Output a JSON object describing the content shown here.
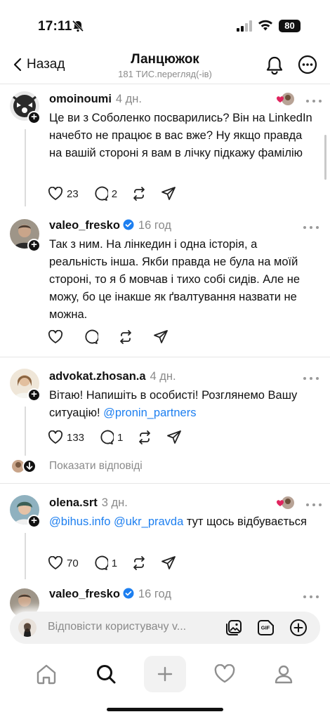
{
  "status_bar": {
    "time": "17:11",
    "battery": "80"
  },
  "header": {
    "back_label": "Назад",
    "title": "Ланцюжок",
    "subtitle": "181 ТИС.перегляд(-ів)"
  },
  "posts": [
    {
      "username": "omoinoumi",
      "time": "4 дн.",
      "verified": false,
      "text": "Це ви з Соболенко посварились? Він на LinkedIn начебто не працює в вас вже? Ну якщо правда на вашій стороні я вам в лічку підкажу фамілію",
      "likes": "23",
      "comments": "2"
    },
    {
      "username": "valeo_fresko",
      "time": "16 год",
      "verified": true,
      "text": "Так з ним. На лінкедин і одна історія, а реальність інша. Якби правда не була на моїй стороні, то я б мовчав і тихо собі сидів. Але не можу, бо це інакше як ґвалтування назвати не можна.",
      "likes": "",
      "comments": ""
    },
    {
      "username": "advokat.zhosan.a",
      "time": "4 дн.",
      "verified": false,
      "text": "Вітаю! Напишіть в особисті! Розглянемо Вашу ситуацію!",
      "mention": "@pronin_partners",
      "likes": "133",
      "comments": "1"
    },
    {
      "username": "olena.srt",
      "time": "3 дн.",
      "verified": false,
      "mention1": "@bihus.info",
      "mention2": "@ukr_pravda",
      "text": "тут щось відбувається",
      "likes": "70",
      "comments": "1"
    },
    {
      "username": "valeo_fresko",
      "time": "16 год",
      "verified": true
    }
  ],
  "show_replies": "Показати відповіді",
  "reply_bar": {
    "placeholder": "Відповісти користувачу v..."
  },
  "icons": {
    "like": "heart-icon",
    "comment": "comment-icon",
    "repost": "repost-icon",
    "share": "share-icon"
  },
  "colors": {
    "accent": "#1d7ff0",
    "like_red": "#e0245e"
  }
}
